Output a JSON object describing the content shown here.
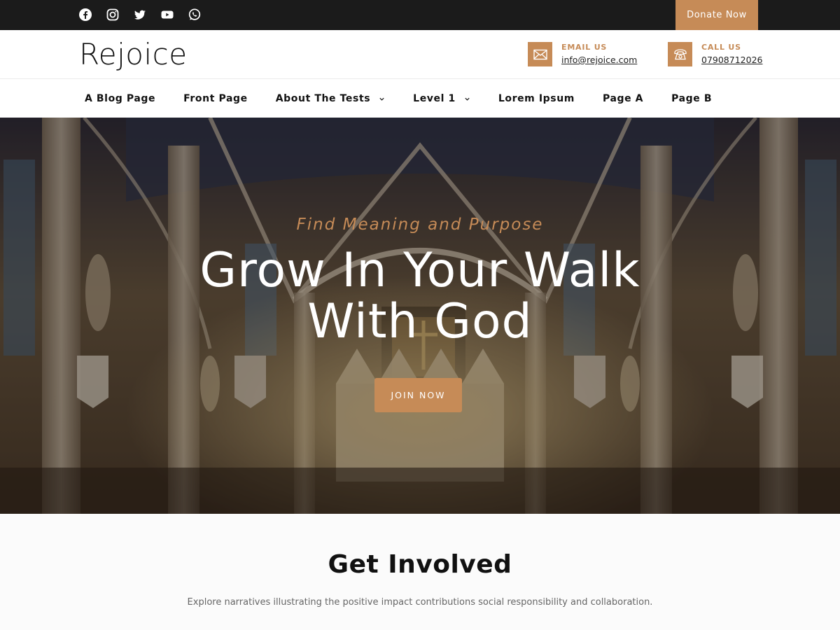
{
  "topbar": {
    "social": [
      {
        "name": "facebook-icon"
      },
      {
        "name": "instagram-icon"
      },
      {
        "name": "twitter-icon"
      },
      {
        "name": "youtube-icon"
      },
      {
        "name": "whatsapp-icon"
      }
    ],
    "donate_label": "Donate Now"
  },
  "header": {
    "logo": "Rejoice",
    "email": {
      "label": "EMAIL US",
      "value": "info@rejoice.com",
      "icon": "envelope-icon"
    },
    "phone": {
      "label": "CALL US",
      "value": "07908712026",
      "icon": "phone-icon"
    }
  },
  "nav": {
    "items": [
      {
        "label": "A Blog Page"
      },
      {
        "label": "Front Page"
      },
      {
        "label": "About The Tests",
        "dropdown": true
      },
      {
        "label": "Level 1",
        "dropdown": true
      },
      {
        "label": "Lorem Ipsum"
      },
      {
        "label": "Page A"
      },
      {
        "label": "Page B"
      }
    ]
  },
  "hero": {
    "kicker": "Find Meaning and Purpose",
    "title": "Grow In Your Walk With God",
    "button": "JOIN NOW"
  },
  "involved": {
    "title": "Get Involved",
    "subtitle": "Explore narratives illustrating the positive impact contributions social responsibility and collaboration."
  },
  "colors": {
    "accent": "#c68b57",
    "topbar": "#1b1b1b"
  }
}
